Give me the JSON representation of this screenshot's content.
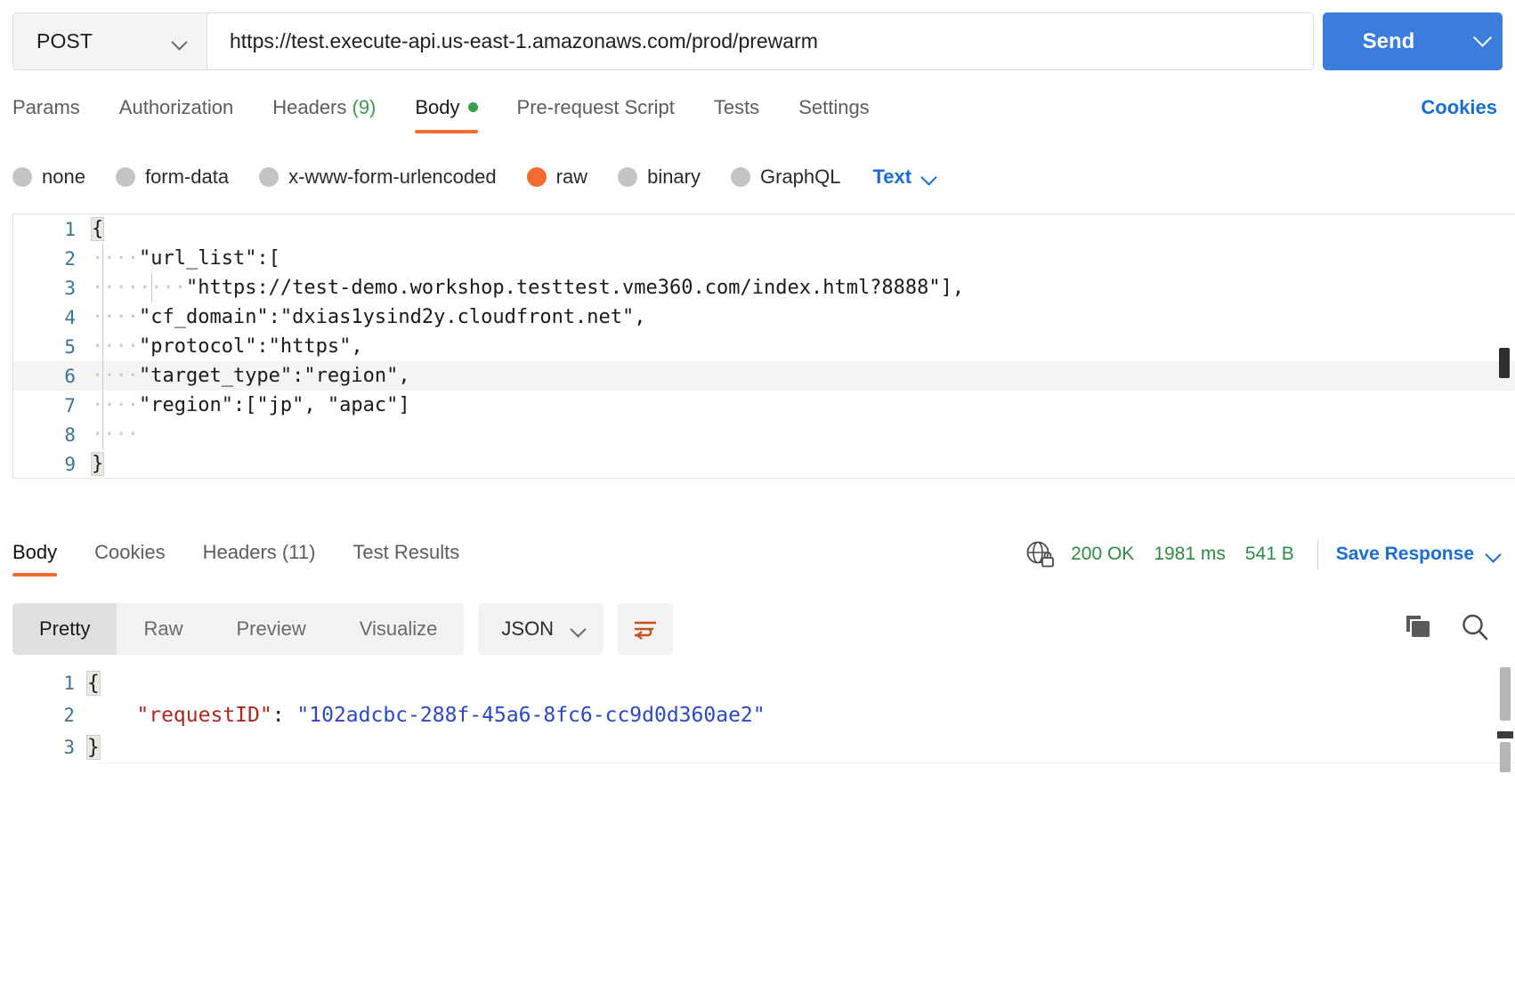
{
  "request": {
    "method": "POST",
    "url": "https://test.execute-api.us-east-1.amazonaws.com/prod/prewarm",
    "send_label": "Send",
    "tabs": [
      {
        "label": "Params",
        "count": "",
        "active": false
      },
      {
        "label": "Authorization",
        "count": "",
        "active": false
      },
      {
        "label": "Headers",
        "count": "(9)",
        "active": false
      },
      {
        "label": "Body",
        "count": "",
        "active": true
      },
      {
        "label": "Pre-request Script",
        "count": "",
        "active": false
      },
      {
        "label": "Tests",
        "count": "",
        "active": false
      },
      {
        "label": "Settings",
        "count": "",
        "active": false
      }
    ],
    "cookies_link": "Cookies",
    "body_types": [
      {
        "label": "none",
        "selected": false
      },
      {
        "label": "form-data",
        "selected": false
      },
      {
        "label": "x-www-form-urlencoded",
        "selected": false
      },
      {
        "label": "raw",
        "selected": true
      },
      {
        "label": "binary",
        "selected": false
      },
      {
        "label": "GraphQL",
        "selected": false
      }
    ],
    "raw_format": "Text",
    "editor_lines": [
      {
        "num": "1",
        "text": "{",
        "indent_dots": 0,
        "highlight": false,
        "brace": true
      },
      {
        "num": "2",
        "text": "\"url_list\":[",
        "indent_dots": 4,
        "highlight": false,
        "brace": false
      },
      {
        "num": "3",
        "text": "\"https://test-demo.workshop.testtest.vme360.com/index.html?8888\"],",
        "indent_dots": 8,
        "highlight": false,
        "brace": false
      },
      {
        "num": "4",
        "text": "\"cf_domain\":\"dxias1ysind2y.cloudfront.net\",",
        "indent_dots": 4,
        "highlight": false,
        "brace": false
      },
      {
        "num": "5",
        "text": "\"protocol\":\"https\",",
        "indent_dots": 4,
        "highlight": false,
        "brace": false
      },
      {
        "num": "6",
        "text": "\"target_type\":\"region\",",
        "indent_dots": 4,
        "highlight": true,
        "brace": false
      },
      {
        "num": "7",
        "text": "\"region\":[\"jp\", \"apac\"]",
        "indent_dots": 4,
        "highlight": false,
        "brace": false
      },
      {
        "num": "8",
        "text": "",
        "indent_dots": 4,
        "highlight": false,
        "brace": false
      },
      {
        "num": "9",
        "text": "}",
        "indent_dots": 0,
        "highlight": false,
        "brace": true
      }
    ]
  },
  "response": {
    "tabs": [
      {
        "label": "Body",
        "count": "",
        "active": true
      },
      {
        "label": "Cookies",
        "count": "",
        "active": false
      },
      {
        "label": "Headers",
        "count": "(11)",
        "active": false
      },
      {
        "label": "Test Results",
        "count": "",
        "active": false
      }
    ],
    "status": "200 OK",
    "time": "1981 ms",
    "size": "541 B",
    "save_response": "Save Response",
    "view_modes": [
      {
        "label": "Pretty",
        "active": true
      },
      {
        "label": "Raw",
        "active": false
      },
      {
        "label": "Preview",
        "active": false
      },
      {
        "label": "Visualize",
        "active": false
      }
    ],
    "format": "JSON",
    "body_lines": [
      {
        "num": "1",
        "open_brace": "{",
        "key": "",
        "colon": "",
        "value": "",
        "close_brace": ""
      },
      {
        "num": "2",
        "open_brace": "",
        "key": "\"requestID\"",
        "colon": ":",
        "value": "\"102adcbc-288f-45a6-8fc6-cc9d0d360ae2\"",
        "close_brace": ""
      },
      {
        "num": "3",
        "open_brace": "",
        "key": "",
        "colon": "",
        "value": "",
        "close_brace": "}"
      }
    ]
  },
  "colors": {
    "accent": "#f26c31",
    "link": "#1a6dd4",
    "success": "#2e8b43",
    "send": "#3b7ddd"
  }
}
